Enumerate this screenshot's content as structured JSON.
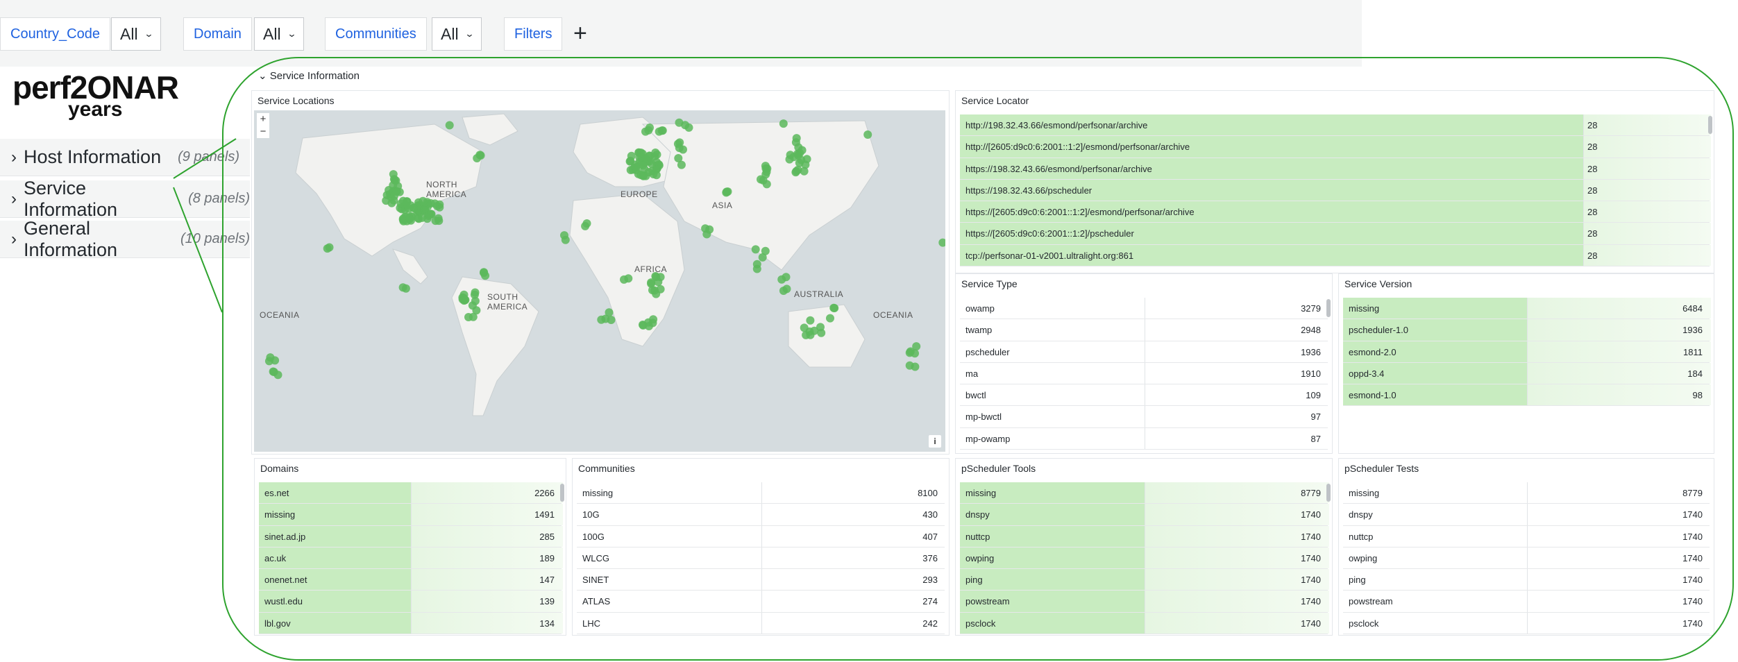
{
  "filters": [
    {
      "label": "Country_Code",
      "value": "All"
    },
    {
      "label": "Domain",
      "value": "All"
    },
    {
      "label": "Communities",
      "value": "All"
    }
  ],
  "filters_button": "Filters",
  "add_button": "+",
  "logo": {
    "main": "perf2ONAR",
    "sub": "years"
  },
  "row_groups": [
    {
      "title": "Host Information",
      "count": "(9 panels)"
    },
    {
      "title": "Service Information",
      "count": "(8 panels)"
    },
    {
      "title": "General Information",
      "count": "(10 panels)"
    }
  ],
  "section_title": "Service Information",
  "map": {
    "title": "Service Locations",
    "zoom_in": "+",
    "zoom_out": "−",
    "info": "i",
    "labels": [
      "NORTH AMERICA",
      "SOUTH AMERICA",
      "EUROPE",
      "ASIA",
      "AFRICA",
      "AUSTRALIA",
      "OCEANIA",
      "OCEANIA"
    ],
    "point_color": "#5cb85c"
  },
  "service_locator": {
    "title": "Service Locator",
    "rows": [
      {
        "name": "http://198.32.43.66/esmond/perfsonar/archive",
        "value": "28"
      },
      {
        "name": "http://[2605:d9c0:6:2001::1:2]/esmond/perfsonar/archive",
        "value": "28"
      },
      {
        "name": "https://198.32.43.66/esmond/perfsonar/archive",
        "value": "28"
      },
      {
        "name": "https://198.32.43.66/pscheduler",
        "value": "28"
      },
      {
        "name": "https://[2605:d9c0:6:2001::1:2]/esmond/perfsonar/archive",
        "value": "28"
      },
      {
        "name": "https://[2605:d9c0:6:2001::1:2]/pscheduler",
        "value": "28"
      },
      {
        "name": "tcp://perfsonar-01-v2001.ultralight.org:861",
        "value": "28"
      }
    ]
  },
  "service_type": {
    "title": "Service Type",
    "rows": [
      {
        "name": "owamp",
        "value": "3279"
      },
      {
        "name": "twamp",
        "value": "2948"
      },
      {
        "name": "pscheduler",
        "value": "1936"
      },
      {
        "name": "ma",
        "value": "1910"
      },
      {
        "name": "bwctl",
        "value": "109"
      },
      {
        "name": "mp-bwctl",
        "value": "97"
      },
      {
        "name": "mp-owamp",
        "value": "87"
      }
    ]
  },
  "service_version": {
    "title": "Service Version",
    "rows": [
      {
        "name": "missing",
        "value": "6484"
      },
      {
        "name": "pscheduler-1.0",
        "value": "1936"
      },
      {
        "name": "esmond-2.0",
        "value": "1811"
      },
      {
        "name": "oppd-3.4",
        "value": "184"
      },
      {
        "name": "esmond-1.0",
        "value": "98"
      }
    ]
  },
  "domains": {
    "title": "Domains",
    "rows": [
      {
        "name": "es.net",
        "value": "2266"
      },
      {
        "name": "missing",
        "value": "1491"
      },
      {
        "name": "sinet.ad.jp",
        "value": "285"
      },
      {
        "name": "ac.uk",
        "value": "189"
      },
      {
        "name": "onenet.net",
        "value": "147"
      },
      {
        "name": "wustl.edu",
        "value": "139"
      },
      {
        "name": "lbl.gov",
        "value": "134"
      }
    ]
  },
  "communities": {
    "title": "Communities",
    "rows": [
      {
        "name": "missing",
        "value": "8100"
      },
      {
        "name": "10G",
        "value": "430"
      },
      {
        "name": "100G",
        "value": "407"
      },
      {
        "name": "WLCG",
        "value": "376"
      },
      {
        "name": "SINET",
        "value": "293"
      },
      {
        "name": "ATLAS",
        "value": "274"
      },
      {
        "name": "LHC",
        "value": "242"
      }
    ]
  },
  "pscheduler_tools": {
    "title": "pScheduler Tools",
    "rows": [
      {
        "name": "missing",
        "value": "8779"
      },
      {
        "name": "dnspy",
        "value": "1740"
      },
      {
        "name": "nuttcp",
        "value": "1740"
      },
      {
        "name": "owping",
        "value": "1740"
      },
      {
        "name": "ping",
        "value": "1740"
      },
      {
        "name": "powstream",
        "value": "1740"
      },
      {
        "name": "psclock",
        "value": "1740"
      }
    ]
  },
  "pscheduler_tests": {
    "title": "pScheduler Tests",
    "rows": [
      {
        "name": "missing",
        "value": "8779"
      },
      {
        "name": "dnspy",
        "value": "1740"
      },
      {
        "name": "nuttcp",
        "value": "1740"
      },
      {
        "name": "owping",
        "value": "1740"
      },
      {
        "name": "ping",
        "value": "1740"
      },
      {
        "name": "powstream",
        "value": "1740"
      },
      {
        "name": "psclock",
        "value": "1740"
      }
    ]
  },
  "colors": {
    "bar": "#c8ecc0",
    "link": "#1f62e0",
    "annotation": "#2ea32e"
  }
}
